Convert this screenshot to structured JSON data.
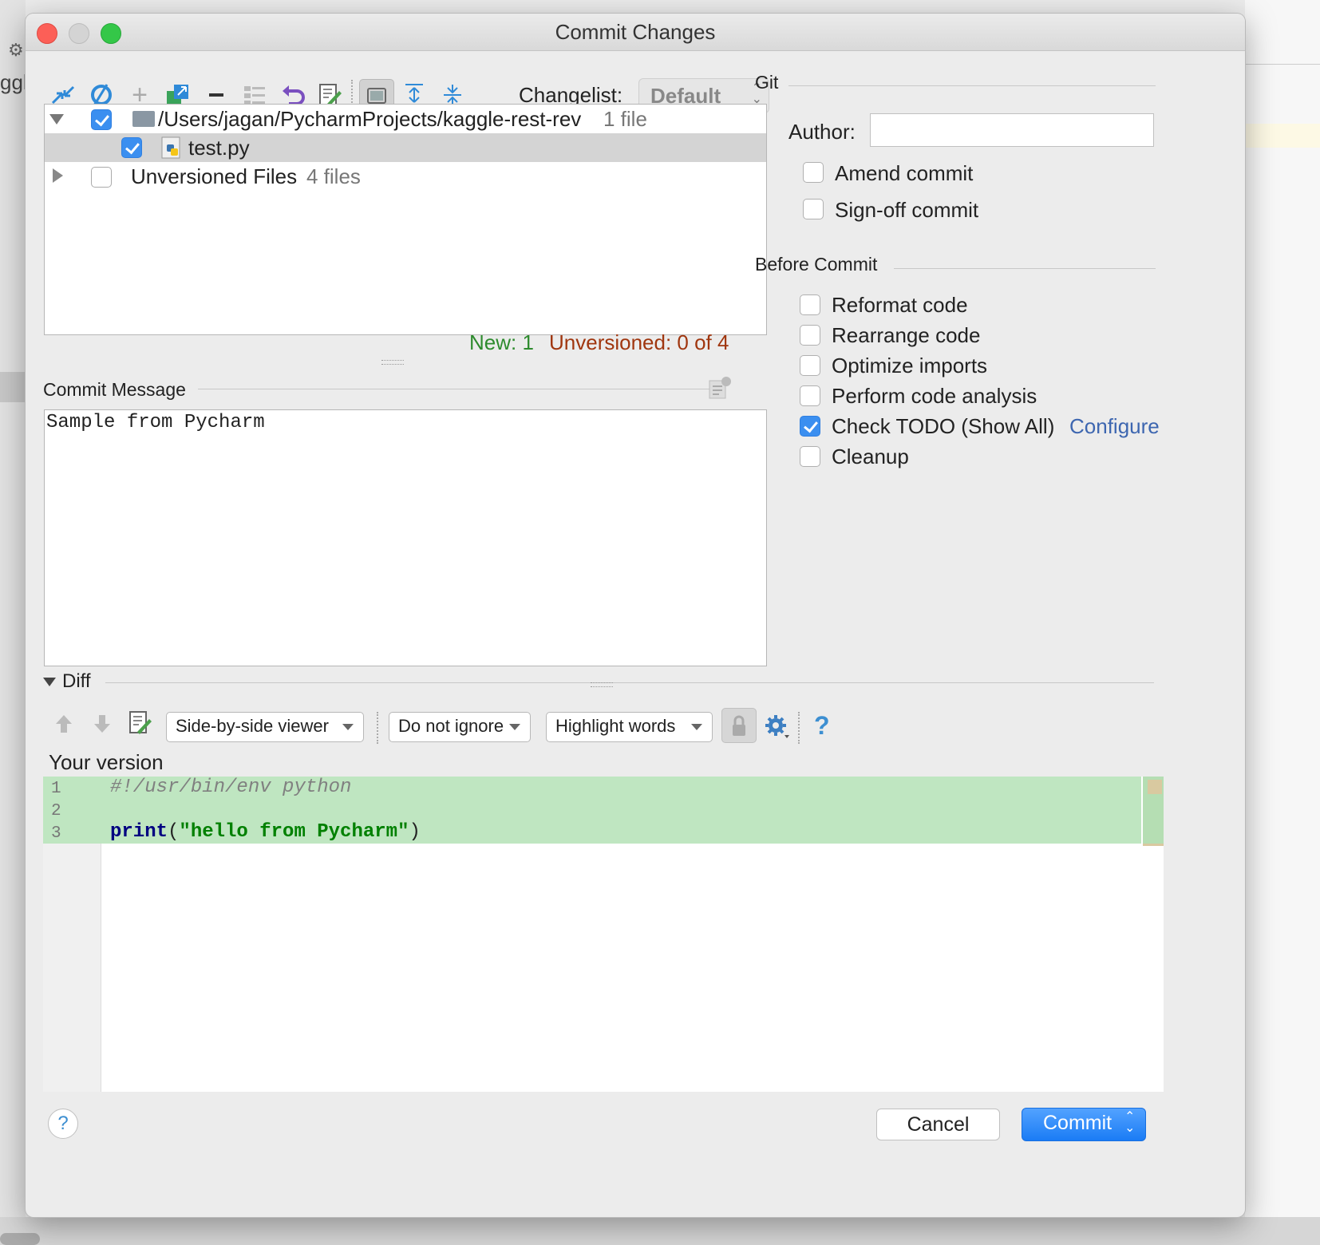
{
  "window": {
    "title": "Commit Changes"
  },
  "toolbar": {
    "changelist_label": "Changelist:",
    "changelist_value": "Default"
  },
  "tree": {
    "root_path": "/Users/jagan/PycharmProjects/kaggle-rest-rev",
    "root_count": "1 file",
    "file_name": "test.py",
    "unversioned_label": "Unversioned Files",
    "unversioned_count": "4 files"
  },
  "status": {
    "new": "New: 1",
    "unversioned": "Unversioned: 0 of 4"
  },
  "commit_message": {
    "label": "Commit Message",
    "text": "Sample from Pycharm"
  },
  "git": {
    "label": "Git",
    "author_label": "Author:",
    "author_value": "",
    "amend": "Amend commit",
    "signoff": "Sign-off commit"
  },
  "before_commit": {
    "label": "Before Commit",
    "options": [
      {
        "label": "Reformat code",
        "checked": false
      },
      {
        "label": "Rearrange code",
        "checked": false
      },
      {
        "label": "Optimize imports",
        "checked": false
      },
      {
        "label": "Perform code analysis",
        "checked": false
      },
      {
        "label": "Check TODO (Show All)",
        "checked": true
      },
      {
        "label": "Cleanup",
        "checked": false
      }
    ],
    "configure_link": "Configure"
  },
  "diff": {
    "label": "Diff",
    "viewer": "Side-by-side viewer",
    "ignore": "Do not ignore",
    "highlight": "Highlight words",
    "help": "?",
    "version_label": "Your version",
    "line_numbers": [
      "1",
      "2",
      "3"
    ],
    "line1": "#!/usr/bin/env python",
    "line3_keyword": "print",
    "line3_open": "(",
    "line3_string": "\"hello from Pycharm\"",
    "line3_close": ")"
  },
  "footer": {
    "help": "?",
    "cancel": "Cancel",
    "commit": "Commit"
  },
  "colors": {
    "accent": "#3b8ff0",
    "new_status": "#2e8b2e",
    "unversioned_status": "#a0360f",
    "diff_added_bg": "#bfe6c1",
    "link": "#3d66b0"
  },
  "icons": [
    "move-icon",
    "refresh-icon",
    "add-icon",
    "new-changelist-icon",
    "remove-icon",
    "group-icon",
    "revert-icon",
    "edit-icon",
    "show-modules-icon",
    "expand-icon",
    "collapse-icon"
  ]
}
